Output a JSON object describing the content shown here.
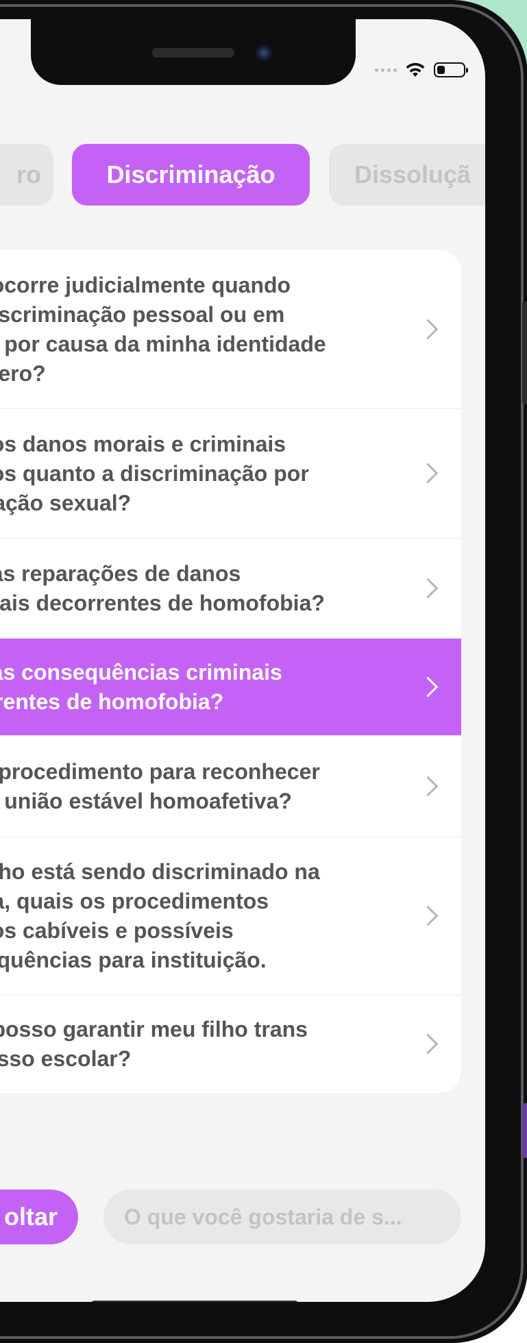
{
  "status_bar": {
    "icons": [
      "cellular-signal-icon",
      "wifi-icon",
      "battery-icon"
    ],
    "battery_level": 0.3
  },
  "colors": {
    "accent": "#c462f6",
    "screen_bg": "#f4f4f4",
    "card_bg": "#ffffff",
    "text_primary": "#555555",
    "text_muted": "#c4c4c4",
    "backdrop_mint": "#aee6cc"
  },
  "tabs": [
    {
      "label": "ro",
      "active": false
    },
    {
      "label": "Discriminação",
      "active": true
    },
    {
      "label": "Dissoluçã",
      "active": false
    }
  ],
  "questions": [
    {
      "text": "e ocorre judicialmente quando\n discriminação pessoal ou em\nco por causa da minha identidade\nênero?",
      "active": false
    },
    {
      "text": "s os danos morais e criminais\nivos quanto a discriminação por\nntação sexual?",
      "active": false
    },
    {
      "text": "s as reparações de danos\neriais decorrentes de homofobia?",
      "active": false
    },
    {
      "text": "s as consequências criminais\norrentes de homofobia?",
      "active": true
    },
    {
      "text": " o procedimento para reconhecer\nna união estável homoafetiva?",
      "active": false
    },
    {
      "text": " filho está sendo discriminado na\nola, quais os procedimentos\nicos cabíveis e possíveis\nsequências para instituição.",
      "active": false
    },
    {
      "text": "o posso garantir meu filho trans\ncesso escolar?",
      "active": false
    }
  ],
  "footer": {
    "back_label": "oltar",
    "input_placeholder": "O que você gostaria de s..."
  }
}
